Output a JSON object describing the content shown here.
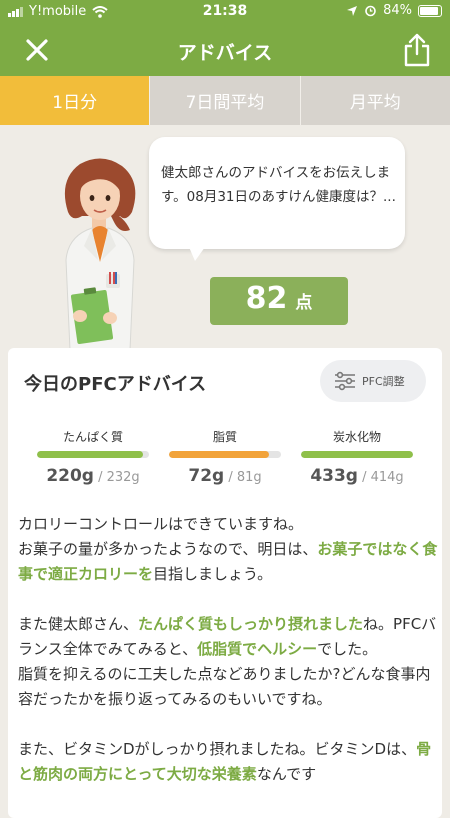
{
  "status_bar": {
    "carrier": "Y!mobile",
    "time": "21:38",
    "battery": "84%"
  },
  "header": {
    "title": "アドバイス"
  },
  "tabs": [
    {
      "label": "1日分",
      "active": true
    },
    {
      "label": "7日間平均",
      "active": false
    },
    {
      "label": "月平均",
      "active": false
    }
  ],
  "bubble": {
    "text": "健太郎さんのアドバイスをお伝えします。08月31日のあすけん健康度は？..."
  },
  "score": {
    "value": "82",
    "unit": "点"
  },
  "card": {
    "title": "今日のPFCアドバイス",
    "pfc_button": "PFC調整",
    "nutrients": [
      {
        "label": "たんぱく質",
        "value": "220g",
        "target": "/ 232g",
        "ratio": 0.95,
        "color": "#8fc04a"
      },
      {
        "label": "脂質",
        "value": "72g",
        "target": "/ 81g",
        "ratio": 0.89,
        "color": "#f2a33a"
      },
      {
        "label": "炭水化物",
        "value": "433g",
        "target": "/ 414g",
        "ratio": 1.0,
        "color": "#8fc04a"
      }
    ],
    "paragraphs": {
      "p1_a": "カロリーコントロールはできていますね。",
      "p1_b": "お菓子の量が多かったようなので、明日は、",
      "p1_hl": "お菓子ではなく食事で適正カロリーを",
      "p1_c": "目指しましょう。",
      "p2_a": "また健太郎さん、",
      "p2_hl1": "たんぱく質もしっかり摂れました",
      "p2_b": "ね。PFCバランス全体でみてみると、",
      "p2_hl2": "低脂質でヘルシー",
      "p2_c": "でした。",
      "p2_d": "脂質を抑えるのに工夫した点などありましたか?どんな食事内容だったかを振り返ってみるのもいいですね。",
      "p3_a": "また、ビタミンDがしっかり摂れましたね。ビタミンDは、",
      "p3_hl": "骨と筋肉の両方にとって大切な栄養素",
      "p3_b": "なんです"
    }
  },
  "colors": {
    "primary_green": "#7dab44",
    "tab_active": "#f2bd3a",
    "highlight": "#7dab44"
  }
}
